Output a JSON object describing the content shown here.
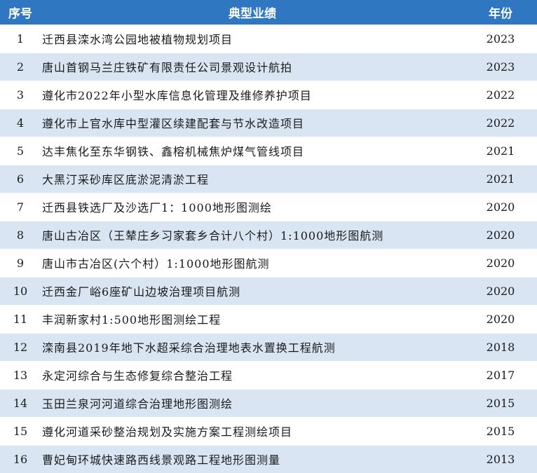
{
  "header": {
    "num": "序号",
    "name": "典型业绩",
    "year": "年份"
  },
  "rows": [
    {
      "num": "1",
      "name": "迁西县滦水湾公园地被植物规划项目",
      "year": "2023"
    },
    {
      "num": "2",
      "name": "唐山首钢马兰庄铁矿有限责任公司景观设计航拍",
      "year": "2023"
    },
    {
      "num": "3",
      "name": "遵化市2022年小型水库信息化管理及维修养护项目",
      "year": "2022"
    },
    {
      "num": "4",
      "name": "遵化市上官水库中型灌区续建配套与节水改造项目",
      "year": "2022"
    },
    {
      "num": "5",
      "name": "达丰焦化至东华钢铁、鑫榕机械焦炉煤气管线项目",
      "year": "2021"
    },
    {
      "num": "6",
      "name": "大黑汀采砂库区底淤泥清淤工程",
      "year": "2021"
    },
    {
      "num": "7",
      "name": "迁西县铁选厂及沙选厂1：1000地形图测绘",
      "year": "2020"
    },
    {
      "num": "8",
      "name": "唐山古冶区（王辇庄乡习家套乡合计八个村）1:1000地形图航测",
      "year": "2020"
    },
    {
      "num": "9",
      "name": "唐山市古冶区(六个村）1:1000地形图航测",
      "year": "2020"
    },
    {
      "num": "10",
      "name": "迁西金厂峪6座矿山边坡治理项目航测",
      "year": "2020"
    },
    {
      "num": "11",
      "name": "丰润新家村1:500地形图测绘工程",
      "year": "2020"
    },
    {
      "num": "12",
      "name": "滦南县2019年地下水超采综合治理地表水置换工程航测",
      "year": "2018"
    },
    {
      "num": "13",
      "name": "永定河综合与生态修复综合整治工程",
      "year": "2017"
    },
    {
      "num": "14",
      "name": "玉田兰泉河河道综合治理地形图测绘",
      "year": "2015"
    },
    {
      "num": "15",
      "name": "遵化河道采砂整治规划及实施方案工程测绘项目",
      "year": "2015"
    },
    {
      "num": "16",
      "name": "曹妃甸环城快速路西线景观路工程地形图测量",
      "year": "2013"
    }
  ]
}
